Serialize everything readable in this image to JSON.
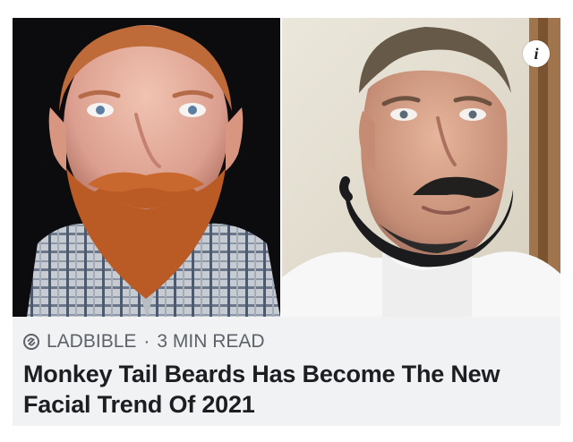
{
  "article": {
    "info_icon_glyph": "i",
    "source": "LADBIBLE",
    "separator": "·",
    "read_time": "3 MIN READ",
    "headline": "Monkey Tail Beards Has Become The New Facial Trend Of 2021",
    "images": [
      {
        "name": "left-photo",
        "subject": "red beard"
      },
      {
        "name": "right-photo",
        "subject": "monkey tail beard"
      }
    ]
  },
  "icons": {
    "info": "info-icon",
    "source": "link-icon"
  },
  "colors": {
    "card_background": "#f1f2f4",
    "headline": "#1c1e21",
    "meta": "#5d6268"
  }
}
